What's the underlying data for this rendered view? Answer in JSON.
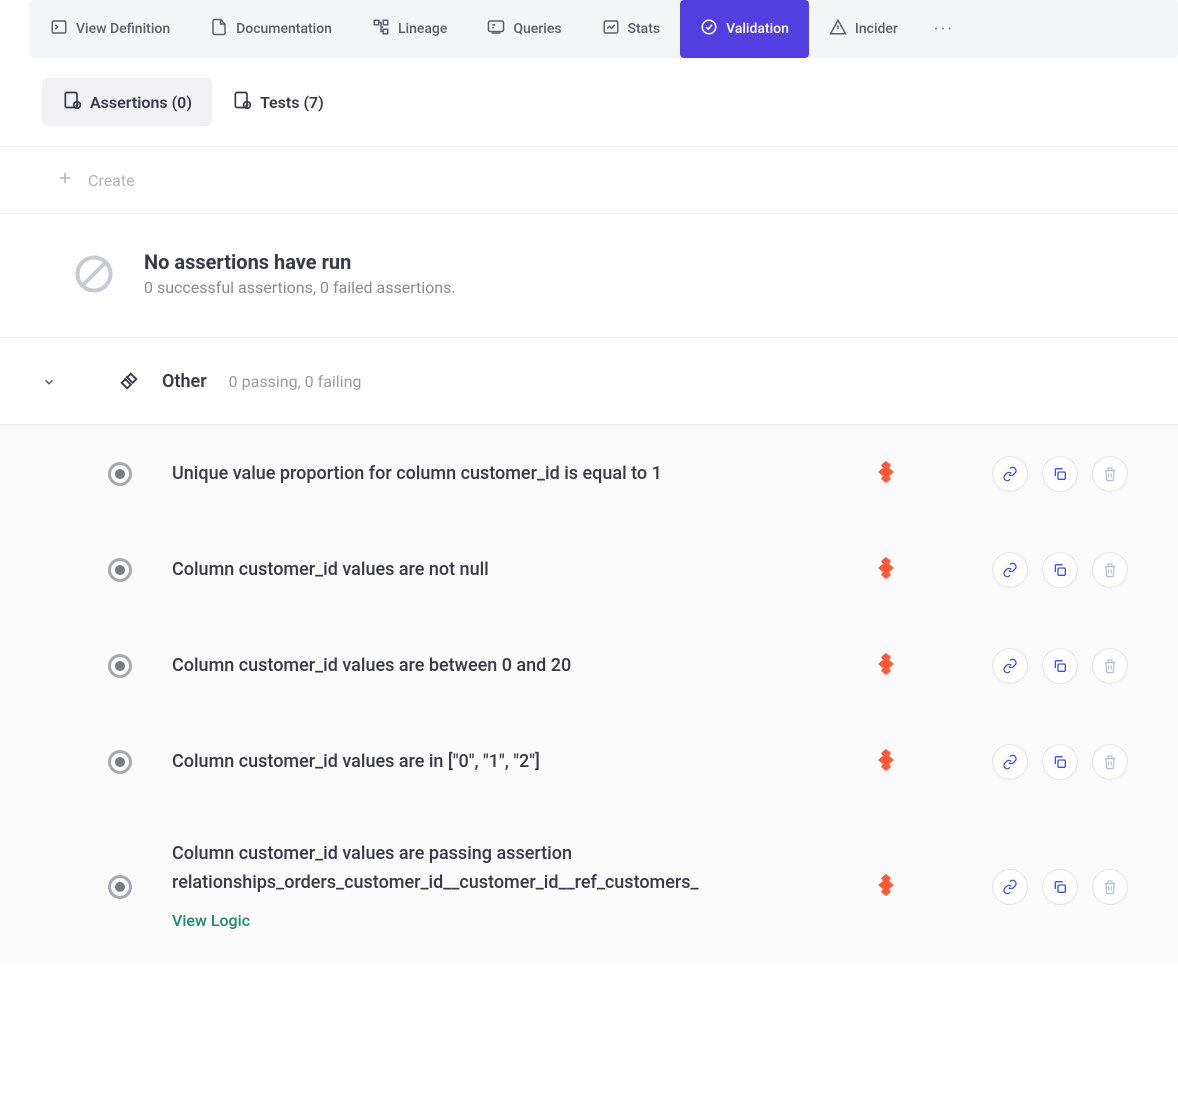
{
  "tabs": {
    "view_definition": "View Definition",
    "documentation": "Documentation",
    "lineage": "Lineage",
    "queries": "Queries",
    "stats": "Stats",
    "validation": "Validation",
    "incidents": "Incider",
    "more": "···"
  },
  "subtabs": {
    "assertions_label": "Assertions (0)",
    "tests_label": "Tests (7)"
  },
  "create_label": "Create",
  "empty": {
    "title": "No assertions have run",
    "subtitle": "0 successful assertions, 0 failed assertions."
  },
  "group": {
    "name": "Other",
    "meta": "0 passing, 0 failing"
  },
  "rules": [
    {
      "text": "Unique value proportion for column customer_id is equal to 1",
      "has_view_logic": false
    },
    {
      "text": "Column customer_id values are not null",
      "has_view_logic": false
    },
    {
      "text": "Column customer_id values are between 0 and 20",
      "has_view_logic": false
    },
    {
      "text": "Column customer_id values are in [\"0\", \"1\", \"2\"]",
      "has_view_logic": false
    },
    {
      "text": "Column customer_id values are passing assertion relationships_orders_customer_id__customer_id__ref_customers_",
      "has_view_logic": true
    }
  ],
  "view_logic_label": "View Logic"
}
